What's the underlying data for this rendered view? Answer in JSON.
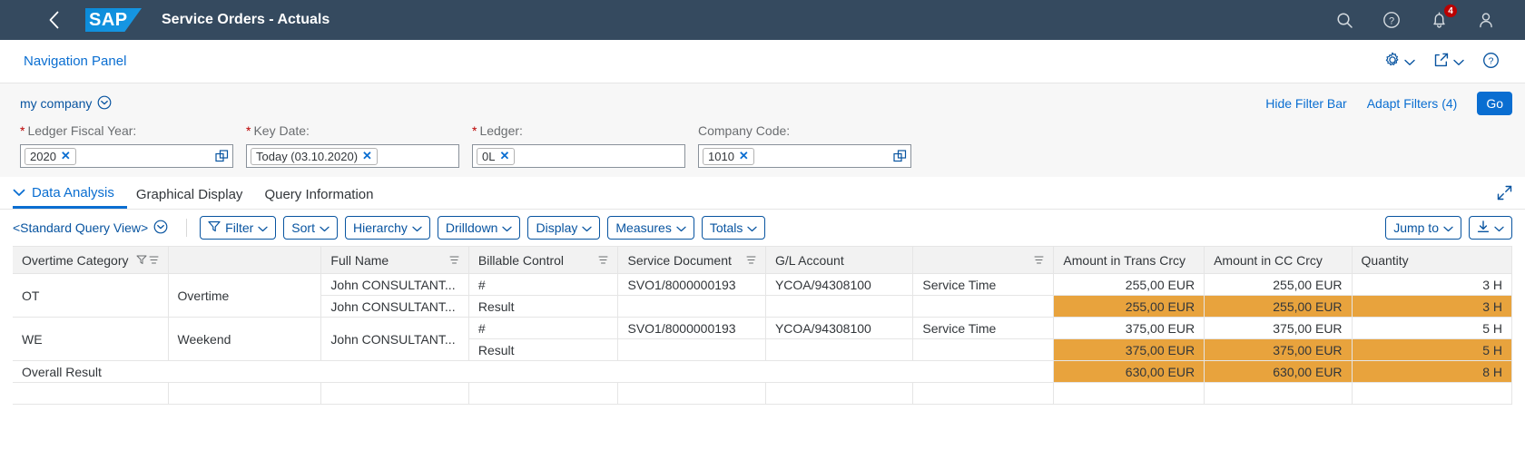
{
  "shell": {
    "back_icon": "back-chevron-icon",
    "logo_text": "SAP",
    "title": "Service Orders - Actuals",
    "icons": [
      {
        "name": "search-icon",
        "label": "Search"
      },
      {
        "name": "help-icon",
        "label": "Help"
      },
      {
        "name": "notifications-bell-icon",
        "label": "Notifications",
        "badge": "4"
      },
      {
        "name": "user-avatar-icon",
        "label": "User"
      }
    ]
  },
  "navstrip": {
    "label": "Navigation Panel",
    "actions": [
      {
        "name": "settings-gear-icon",
        "label": "Settings"
      },
      {
        "name": "share-icon",
        "label": "Share"
      },
      {
        "name": "help-icon",
        "label": "Help"
      }
    ]
  },
  "filterbar": {
    "variant": "my company",
    "hide_filter_bar": "Hide Filter Bar",
    "adapt_filters": "Adapt Filters (4)",
    "go": "Go",
    "fields": [
      {
        "label": "Ledger Fiscal Year:",
        "required": true,
        "value": "2020",
        "value_help": true
      },
      {
        "label": "Key Date:",
        "required": true,
        "value": "Today (03.10.2020)",
        "value_help": false
      },
      {
        "label": "Ledger:",
        "required": true,
        "value": "0L",
        "value_help": false
      },
      {
        "label": "Company Code:",
        "required": false,
        "value": "1010",
        "value_help": true
      }
    ]
  },
  "tabs": [
    {
      "label": "Data Analysis",
      "active": true
    },
    {
      "label": "Graphical Display",
      "active": false
    },
    {
      "label": "Query Information",
      "active": false
    }
  ],
  "tabbar_right_icon": "fullscreen-icon",
  "toolbar": {
    "query_view": "<Standard Query View>",
    "buttons": [
      {
        "label": "Filter",
        "icon": "filter-icon"
      },
      {
        "label": "Sort",
        "icon": null
      },
      {
        "label": "Hierarchy",
        "icon": null
      },
      {
        "label": "Drilldown",
        "icon": null
      },
      {
        "label": "Display",
        "icon": null
      },
      {
        "label": "Measures",
        "icon": null
      },
      {
        "label": "Totals",
        "icon": null
      }
    ],
    "jump_to": "Jump to",
    "download_icon": "download-icon"
  },
  "table": {
    "columns": [
      {
        "label": "Overtime Category",
        "icons": [
          "filter-icon",
          "sort-icon"
        ],
        "align": "left"
      },
      {
        "label": "",
        "icons": [],
        "align": "left"
      },
      {
        "label": "Full Name",
        "icons": [
          "sort-icon"
        ],
        "align": "left"
      },
      {
        "label": "Billable Control",
        "icons": [
          "sort-icon"
        ],
        "align": "left"
      },
      {
        "label": "Service Document",
        "icons": [
          "sort-icon"
        ],
        "align": "left"
      },
      {
        "label": "G/L Account",
        "icons": [],
        "align": "left"
      },
      {
        "label": "",
        "icons": [
          "sort-icon"
        ],
        "align": "left"
      },
      {
        "label": "Amount in Trans Crcy",
        "icons": [],
        "align": "right"
      },
      {
        "label": "Amount in CC Crcy",
        "icons": [],
        "align": "right"
      },
      {
        "label": "Quantity",
        "icons": [],
        "align": "right"
      }
    ],
    "rows": [
      {
        "type": "data",
        "category_key": "OT",
        "category_text": "Overtime",
        "full_name": "John CONSULTANT...",
        "billable_control": "#",
        "service_document": "SVO1/8000000193",
        "gl_account": "YCOA/94308100",
        "gl_text": "Service Time",
        "amount_trans": "255,00 EUR",
        "amount_cc": "255,00 EUR",
        "quantity": "3 H"
      },
      {
        "type": "result",
        "category_key": "",
        "category_text": "",
        "full_name": "John CONSULTANT...",
        "billable_control": "Result",
        "service_document": "",
        "gl_account": "",
        "gl_text": "",
        "amount_trans": "255,00 EUR",
        "amount_cc": "255,00 EUR",
        "quantity": "3 H"
      },
      {
        "type": "data",
        "category_key": "WE",
        "category_text": "Weekend",
        "full_name": "John CONSULTANT...",
        "billable_control": "#",
        "service_document": "SVO1/8000000193",
        "gl_account": "YCOA/94308100",
        "gl_text": "Service Time",
        "amount_trans": "375,00 EUR",
        "amount_cc": "375,00 EUR",
        "quantity": "5 H"
      },
      {
        "type": "result",
        "category_key": "",
        "category_text": "",
        "full_name": "",
        "billable_control": "Result",
        "service_document": "",
        "gl_account": "",
        "gl_text": "",
        "amount_trans": "375,00 EUR",
        "amount_cc": "375,00 EUR",
        "quantity": "5 H"
      },
      {
        "type": "overall",
        "category_key": "Overall Result",
        "category_text": "",
        "full_name": "",
        "billable_control": "",
        "service_document": "",
        "gl_account": "",
        "gl_text": "",
        "amount_trans": "630,00 EUR",
        "amount_cc": "630,00 EUR",
        "quantity": "8 H"
      }
    ]
  },
  "colors": {
    "shell_bg": "#354a5f",
    "accent": "#0a6ed1",
    "link": "#0854a0",
    "result_highlight": "#e8a33d",
    "required_star": "#bb0000",
    "badge_bg": "#bb0000"
  }
}
